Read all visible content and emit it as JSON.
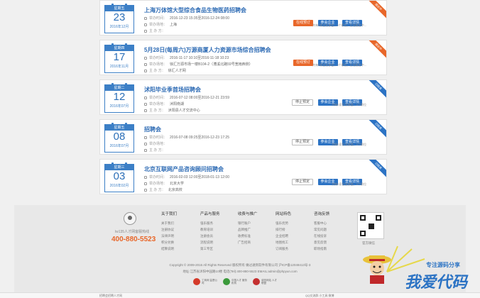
{
  "labels": {
    "time": "举办时间：",
    "venue": "举办场地：",
    "organizer": "主  办  方："
  },
  "fairs": [
    {
      "weekday": "星期五",
      "day": "23",
      "ym": "2016年12月",
      "title": "上海万体馆大型综合食品生物医药招聘会",
      "time": "2016-12-23 15:35至2016-12-24 08:00",
      "venue": "上海",
      "organizer": "",
      "buttons": [
        "在线预订",
        "参会企业",
        "查看详情"
      ],
      "note": "共有0家企业参会，0个职位，正在报名中...",
      "ribbon": "报名中",
      "status": "hot"
    },
    {
      "weekday": "星期四",
      "day": "17",
      "ym": "2016年11月",
      "title": "5月28日(每周六)万源商厦人力资源市场综合招聘会",
      "time": "2016-11-17 10:10至2016-11-18 10:23",
      "venue": "徐汇万源市场一楼B104-2（漕溪北路59号宽雨西侧）",
      "organizer": "徐汇人才网",
      "buttons": [
        "在线预订",
        "参会企业",
        "查看详情"
      ],
      "note": "共有0家企业参会，0个职位，正在报名中...",
      "ribbon": "报名中",
      "status": "hot"
    },
    {
      "weekday": "星期二",
      "day": "12",
      "ym": "2016年07月",
      "title": "沭阳毕业季首场招聘会",
      "time": "2016-07-12 08:00至2016-12-21 23:59",
      "venue": "沭阳南湖",
      "organizer": "沭阳县人才交流中心",
      "buttons": [
        "停止预定",
        "参会企业",
        "查看详情"
      ],
      "note": "共有0家企业参会，0个职位",
      "ribbon": "已结束",
      "status": "done"
    },
    {
      "weekday": "星期五",
      "day": "08",
      "ym": "2016年07月",
      "title": "招聘会",
      "time": "2016-07-08 09:25至2016-12-23 17:25",
      "venue": "",
      "organizer": "",
      "buttons": [
        "停止预定",
        "参会企业",
        "查看详情"
      ],
      "note": "共有0家企业参会，0个职位",
      "ribbon": "已结束",
      "status": "done"
    },
    {
      "weekday": "星期三",
      "day": "03",
      "ym": "2016年02月",
      "title": "北京互联网产品咨询顾问招聘会",
      "time": "2016-02-03 12:00至2018-01-13 12:00",
      "venue": "北京大学",
      "organizer": "北京高校",
      "buttons": [
        "停止预定",
        "参会企业",
        "查看详情"
      ],
      "note": "共有0家企业参会，0个职位",
      "ribbon": "已结束",
      "status": "done"
    }
  ],
  "footer": {
    "hotline_label": "lw135人才网客服热线",
    "hotline": "400-880-5523",
    "columns": [
      {
        "title": "关于我们",
        "items": [
          "关于我们",
          "注册协议",
          "法律声明",
          "积分兑换",
          "结算说明"
        ]
      },
      {
        "title": "产品与服务",
        "items": [
          "强乐服务",
          "教育培训",
          "注册会员",
          "流程说明",
          "第三专区"
        ]
      },
      {
        "title": "收费与推广",
        "items": [
          "银行账户",
          "品牌推广",
          "收费标准",
          "广告招商"
        ]
      },
      {
        "title": "网站特色",
        "items": [
          "强乐优势",
          "排行榜",
          "企业招聘",
          "地图找工",
          "订阅服务"
        ]
      },
      {
        "title": "咨询反馈",
        "items": [
          "客服中心",
          "常见问题",
          "在线投诉",
          "意见反馈",
          "职场指南"
        ]
      }
    ],
    "qr_label": "官方微信",
    "copyright": "Copyright © 2009-2016 All Rights Reserved 版权所有 做过通到软件有限公司 沪ICP备12049413号-3",
    "address": "地址:江苏省沭阳中园路10楼 电话(Tel):400-880-5523 EMAIL:admin@phpyun.com",
    "badges": [
      {
        "text": "工商网 监督公司",
        "color": "#d43a2a"
      },
      {
        "text": "中国人才 服务机构",
        "color": "#3b9a3b"
      },
      {
        "text": "诚信网站 人才联盟",
        "color": "#c43030"
      }
    ]
  },
  "bottom_bar": {
    "left": "招聘会招聘人才网",
    "right": "QQ交流群 小工具 微博"
  },
  "watermark": {
    "slogan": "专注源码分享",
    "brand": "我爱代码"
  },
  "colors": {
    "primary": "#2c73c4",
    "accent": "#e8672a"
  }
}
